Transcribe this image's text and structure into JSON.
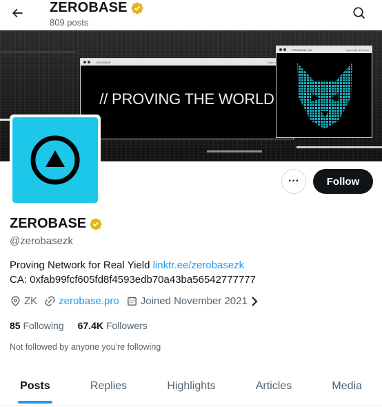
{
  "header": {
    "name": "ZEROBASE",
    "posts_count": "809 posts"
  },
  "banner": {
    "slogan": "// PROVING THE WORLD",
    "window1_title": "ZEROBASE",
    "window1_action": "Open with Preview",
    "window2_title": "ZEROBASE_cat",
    "window2_action": "Open with Preview"
  },
  "actions": {
    "more_label": "···",
    "follow_label": "Follow"
  },
  "profile": {
    "display_name": "ZEROBASE",
    "handle": "@zerobasezk",
    "bio_text": "Proving Network for Real Yield ",
    "bio_link": "linktr.ee/zerobasezk",
    "bio_ca": "CA: 0xfab99fcf605fd8f4593edb70a43ba56542777777",
    "location": "ZK",
    "website": "zerobase.pro",
    "joined": "Joined November 2021"
  },
  "stats": {
    "following_count": "85",
    "following_label": "Following",
    "followers_count": "67.4K",
    "followers_label": "Followers"
  },
  "not_followed": "Not followed by anyone you're following",
  "tabs": [
    {
      "label": "Posts",
      "active": true
    },
    {
      "label": "Replies",
      "active": false
    },
    {
      "label": "Highlights",
      "active": false
    },
    {
      "label": "Articles",
      "active": false
    },
    {
      "label": "Media",
      "active": false
    }
  ],
  "colors": {
    "accent": "#1d9bf0",
    "verified": "#e2b719",
    "avatar_bg": "#1dc7ea",
    "text_primary": "#0f1419",
    "text_secondary": "#536471"
  },
  "icons": {
    "back": "arrow-left-icon",
    "search": "search-icon",
    "verified": "verified-badge-icon",
    "location": "location-pin-icon",
    "link": "link-icon",
    "calendar": "calendar-icon",
    "chevron": "chevron-right-icon"
  }
}
